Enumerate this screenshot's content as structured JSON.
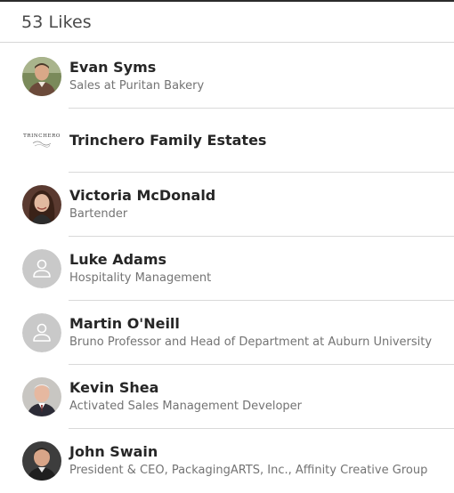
{
  "header": {
    "title": "53 Likes"
  },
  "likes": [
    {
      "name": "Evan Syms",
      "subtitle": "Sales at Puritan Bakery",
      "avatar": "person-photo-icon"
    },
    {
      "name": "Trinchero Family Estates",
      "subtitle": "",
      "avatar": "company-logo",
      "logo_text": "TRINCHERO"
    },
    {
      "name": "Victoria McDonald",
      "subtitle": "Bartender",
      "avatar": "person-photo-icon"
    },
    {
      "name": "Luke Adams",
      "subtitle": "Hospitality Management",
      "avatar": "default-person-icon"
    },
    {
      "name": "Martin O'Neill",
      "subtitle": "Bruno Professor and Head of Department at Auburn University",
      "avatar": "default-person-icon"
    },
    {
      "name": "Kevin Shea",
      "subtitle": "Activated Sales Management Developer",
      "avatar": "person-photo-icon"
    },
    {
      "name": "John Swain",
      "subtitle": "President & CEO, PackagingARTS, Inc., Affinity Creative Group",
      "avatar": "person-photo-icon"
    }
  ],
  "colors": {
    "divider": "#d9d9d9",
    "name_text": "#262626",
    "subtitle_text": "#737373",
    "default_avatar_bg": "#c9c9c9"
  }
}
